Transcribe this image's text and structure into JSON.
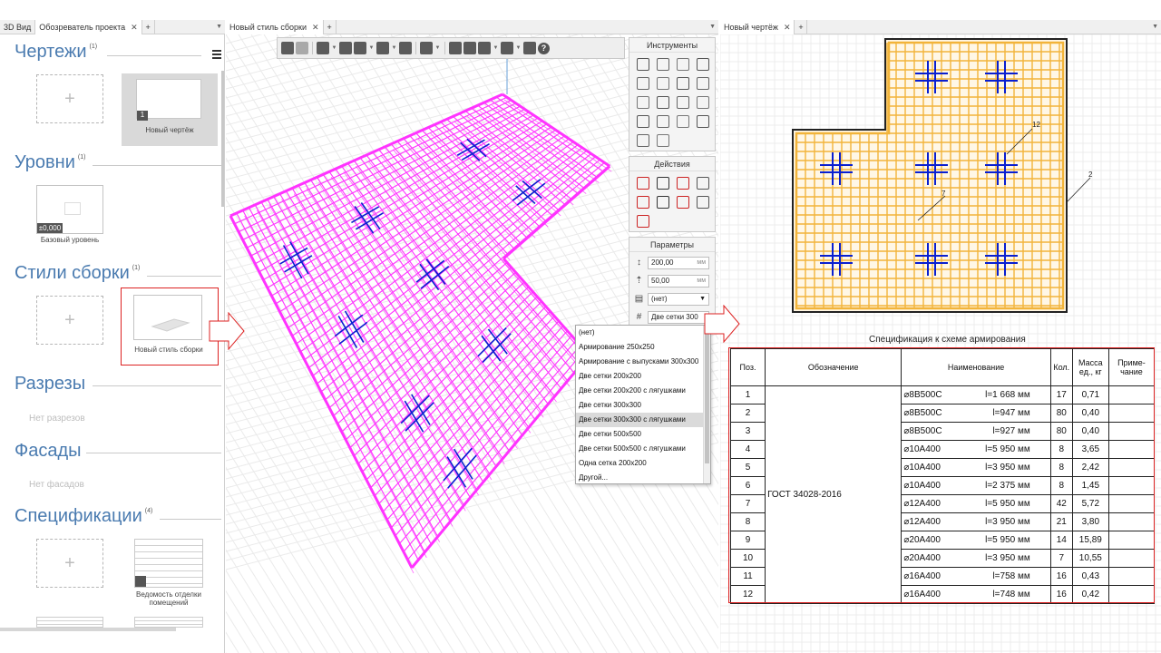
{
  "tabs": {
    "left": [
      {
        "label": "3D Вид"
      },
      {
        "label": "Обозреватель проекта"
      }
    ],
    "mid": [
      {
        "label": "Новый стиль сборки"
      }
    ],
    "right": [
      {
        "label": "Новый чертёж"
      }
    ]
  },
  "left_panel": {
    "drawings": {
      "title": "Чертежи",
      "count": "(1)",
      "items": [
        {
          "label": "Новый чертёж",
          "badge": "1"
        }
      ]
    },
    "levels": {
      "title": "Уровни",
      "count": "(1)",
      "items": [
        {
          "label": "Базовый уровень",
          "badge": "±0,000"
        }
      ]
    },
    "assembly_styles": {
      "title": "Стили сборки",
      "count": "(1)",
      "items": [
        {
          "label": "Новый стиль сборки"
        }
      ]
    },
    "sections": {
      "title": "Разрезы",
      "empty": "Нет разрезов"
    },
    "facades": {
      "title": "Фасады",
      "empty": "Нет фасадов"
    },
    "specs": {
      "title": "Спецификации",
      "count": "(4)",
      "items": [
        {
          "label": "Ведомость отделки помещений"
        }
      ]
    },
    "add_symbol": "+"
  },
  "panels": {
    "tools": {
      "title": "Инструменты"
    },
    "actions": {
      "title": "Действия"
    },
    "params": {
      "title": "Параметры",
      "step": {
        "value": "200,00",
        "unit": "мм"
      },
      "cover": {
        "value": "50,00",
        "unit": "мм"
      },
      "type": {
        "value": "(нет)"
      },
      "mesh": {
        "value": "Две сетки 300"
      }
    }
  },
  "dropdown": {
    "options": [
      "(нет)",
      "Армирование 250х250",
      "Армирование с выпусками 300х300",
      "Две сетки 200х200",
      "Две сетки 200х200 с лягушками",
      "Две сетки 300х300",
      "Две сетки 300х300 с лягушками",
      "Две сетки 500х500",
      "Две сетки 500х500 с лягушками",
      "Одна сетка 200х200",
      "Другой..."
    ],
    "selected": "Две сетки 300х300 с лягушками"
  },
  "drawing": {
    "callouts": [
      "12",
      "7",
      "2"
    ]
  },
  "spec": {
    "title": "Спецификация к схеме армирования",
    "headers": {
      "pos": "Поз.",
      "mark": "Обозначение",
      "name": "Наименование",
      "qty": "Кол.",
      "mass": "Масса ед., кг",
      "note": "Приме- чание"
    },
    "mark": "ГОСТ 34028-2016",
    "rows": [
      {
        "pos": "1",
        "bar": "⌀8В500С",
        "len": "l=1 668 мм",
        "qty": "17",
        "mass": "0,71"
      },
      {
        "pos": "2",
        "bar": "⌀8В500С",
        "len": "l=947 мм",
        "qty": "80",
        "mass": "0,40"
      },
      {
        "pos": "3",
        "bar": "⌀8В500С",
        "len": "l=927 мм",
        "qty": "80",
        "mass": "0,40"
      },
      {
        "pos": "4",
        "bar": "⌀10А400",
        "len": "l=5 950 мм",
        "qty": "8",
        "mass": "3,65"
      },
      {
        "pos": "5",
        "bar": "⌀10А400",
        "len": "l=3 950 мм",
        "qty": "8",
        "mass": "2,42"
      },
      {
        "pos": "6",
        "bar": "⌀10А400",
        "len": "l=2 375 мм",
        "qty": "8",
        "mass": "1,45"
      },
      {
        "pos": "7",
        "bar": "⌀12А400",
        "len": "l=5 950 мм",
        "qty": "42",
        "mass": "5,72"
      },
      {
        "pos": "8",
        "bar": "⌀12А400",
        "len": "l=3 950 мм",
        "qty": "21",
        "mass": "3,80"
      },
      {
        "pos": "9",
        "bar": "⌀20А400",
        "len": "l=5 950 мм",
        "qty": "14",
        "mass": "15,89"
      },
      {
        "pos": "10",
        "bar": "⌀20А400",
        "len": "l=3 950 мм",
        "qty": "7",
        "mass": "10,55"
      },
      {
        "pos": "11",
        "bar": "⌀16А400",
        "len": "l=758 мм",
        "qty": "16",
        "mass": "0,43"
      },
      {
        "pos": "12",
        "bar": "⌀16А400",
        "len": "l=748 мм",
        "qty": "16",
        "mass": "0,42"
      }
    ]
  },
  "colors": {
    "accent_blue": "#4a7bb0",
    "rebar_magenta": "#ff33ff",
    "cross_blue": "#0a1fd0",
    "plan_fill": "#f2b43a",
    "highlight_red": "#d22222"
  }
}
